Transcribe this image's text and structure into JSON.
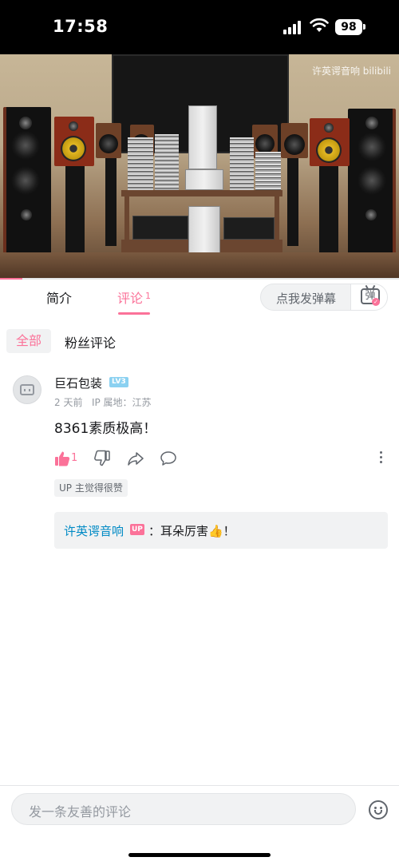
{
  "status_bar": {
    "time": "17:58",
    "battery": "98"
  },
  "video": {
    "watermark": "许英谔音响 bilibili",
    "progress_fraction": 0.056
  },
  "tabs": {
    "intro": "简介",
    "comments": "评论",
    "comment_count": "1",
    "danmaku_placeholder": "点我发弹幕",
    "danmaku_icon_char": "弹"
  },
  "filters": {
    "all": "全部",
    "fans": "粉丝评论"
  },
  "comment": {
    "user_name": "巨石包装",
    "level": "LV3",
    "time": "2 天前",
    "ip_location": "IP 属地：江苏",
    "text": "8361素质极高！",
    "like_count": "1",
    "up_liked_tag": "UP 主觉得很赞",
    "reply": {
      "user": "许英谔音响",
      "up_badge": "UP",
      "text": "：耳朵厉害👍！"
    }
  },
  "bottom": {
    "input_placeholder": "发一条友善的评论"
  },
  "colors": {
    "accent": "#fb7299",
    "link": "#008ac5",
    "level_badge": "#8bd1f1"
  }
}
